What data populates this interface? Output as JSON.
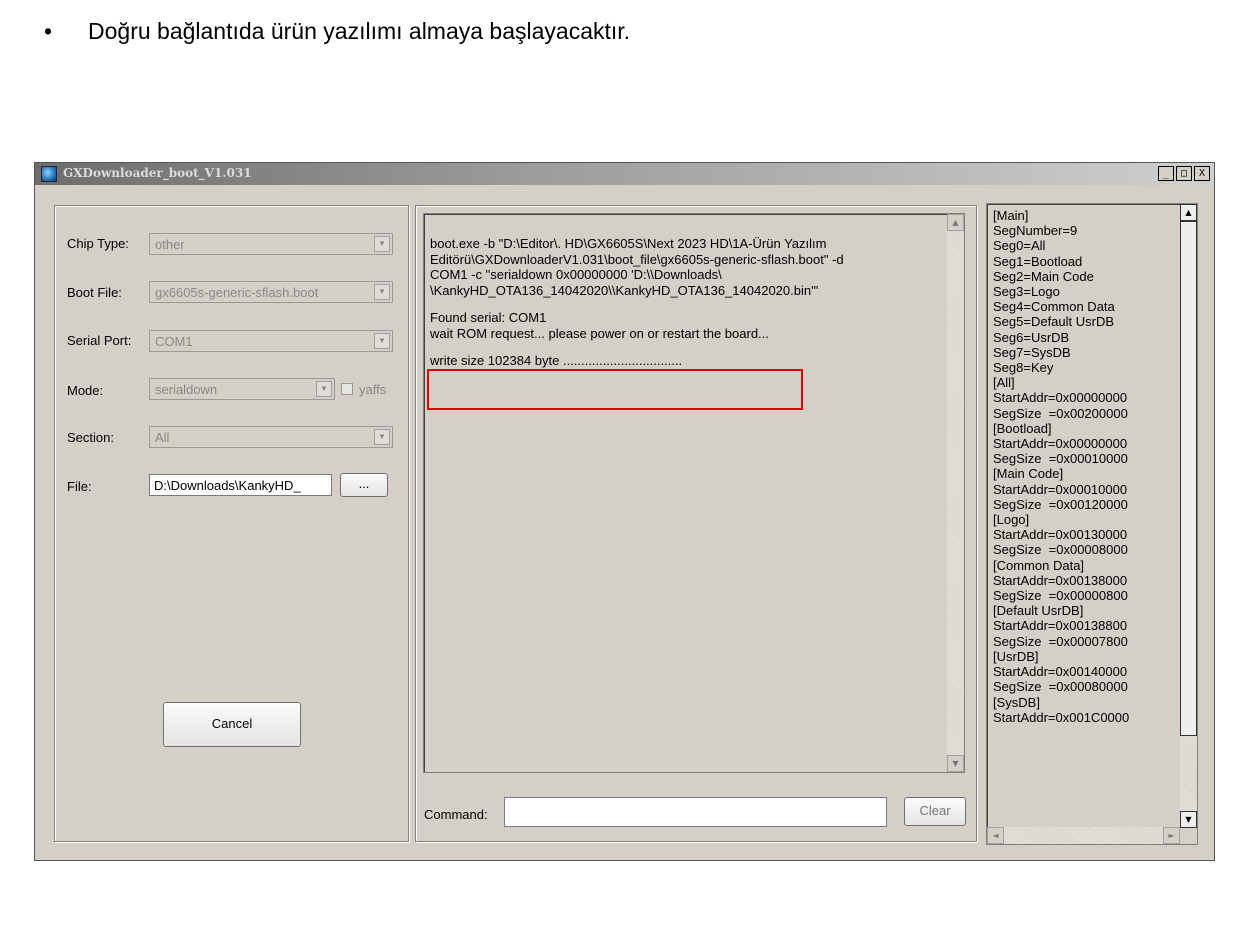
{
  "bullet": {
    "symbol": "•",
    "text": "Doğru bağlantıda ürün yazılımı almaya başlayacaktır."
  },
  "window": {
    "title": "GXDownloader_boot_V1.031",
    "buttons": {
      "minimize": "_",
      "maximize": "□",
      "close": "X"
    }
  },
  "form": {
    "chip_type": {
      "label": "Chip Type:",
      "value": "other"
    },
    "boot_file": {
      "label": "Boot File:",
      "value": "gx6605s-generic-sflash.boot"
    },
    "serial_port": {
      "label": "Serial Port:",
      "value": "COM1"
    },
    "mode": {
      "label": "Mode:",
      "value": "serialdown",
      "yaffs_label": "yaffs"
    },
    "section": {
      "label": "Section:",
      "value": "All"
    },
    "file": {
      "label": "File:",
      "value": "D:\\Downloads\\KankyHD_",
      "browse_label": "..."
    },
    "cancel_label": "Cancel"
  },
  "log": {
    "lines": [
      "boot.exe -b \"D:\\Editor\\. HD\\GX6605S\\Next 2023 HD\\1A-Ürün Yazılım",
      "Editörü\\GXDownloaderV1.031\\boot_file\\gx6605s-generic-sflash.boot\" -d",
      "COM1 -c \"serialdown 0x00000000 'D:\\\\Downloads\\",
      "\\KankyHD_OTA136_14042020\\\\KankyHD_OTA136_14042020.bin'\"",
      "",
      "Found serial: COM1",
      "wait ROM request... please power on or restart the board...",
      "",
      "write size 102384 byte ................................."
    ],
    "command_label": "Command:",
    "command_value": "",
    "clear_label": "Clear"
  },
  "ini": {
    "lines": [
      "[Main]",
      "SegNumber=9",
      "Seg0=All",
      "Seg1=Bootload",
      "Seg2=Main Code",
      "Seg3=Logo",
      "Seg4=Common Data",
      "Seg5=Default UsrDB",
      "Seg6=UsrDB",
      "Seg7=SysDB",
      "Seg8=Key",
      "[All]",
      "StartAddr=0x00000000",
      "SegSize  =0x00200000",
      "[Bootload]",
      "StartAddr=0x00000000",
      "SegSize  =0x00010000",
      "[Main Code]",
      "StartAddr=0x00010000",
      "SegSize  =0x00120000",
      "[Logo]",
      "StartAddr=0x00130000",
      "SegSize  =0x00008000",
      "[Common Data]",
      "StartAddr=0x00138000",
      "SegSize  =0x00000800",
      "[Default UsrDB]",
      "StartAddr=0x00138800",
      "SegSize  =0x00007800",
      "[UsrDB]",
      "StartAddr=0x00140000",
      "SegSize  =0x00080000",
      "[SysDB]",
      "StartAddr=0x001C0000"
    ]
  }
}
